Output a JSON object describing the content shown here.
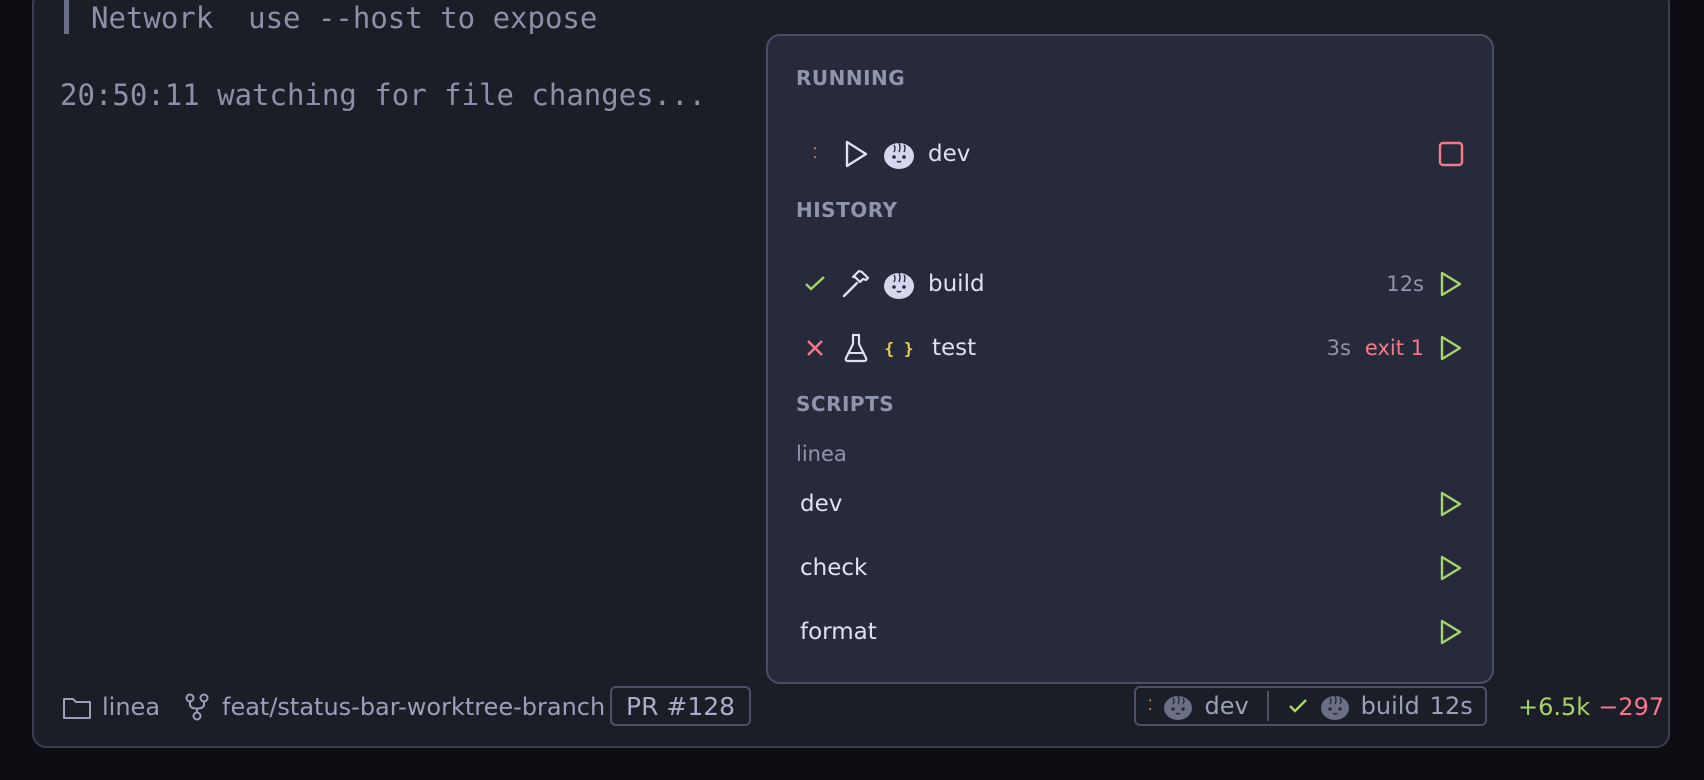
{
  "terminal": {
    "line1": "Network  use --host to expose",
    "line2": "20:50:11 watching for file changes..."
  },
  "popup": {
    "running": {
      "title": "RUNNING",
      "items": [
        {
          "label": "dev",
          "status_icon": "spinner-icon",
          "kind_icon": "play-icon",
          "runtime_icon": "bun-icon",
          "action_icon": "stop-icon"
        }
      ]
    },
    "history": {
      "title": "HISTORY",
      "items": [
        {
          "label": "build",
          "duration": "12s",
          "exit": "",
          "status_icon": "check-icon",
          "kind_icon": "hammer-icon",
          "runtime_icon": "bun-icon",
          "action_icon": "play-icon"
        },
        {
          "label": "test",
          "duration": "3s",
          "exit": "exit 1",
          "status_icon": "x-icon",
          "kind_icon": "flask-icon",
          "runtime_icon": "json-braces-icon",
          "action_icon": "play-icon"
        }
      ]
    },
    "scripts": {
      "title": "SCRIPTS",
      "group": "linea",
      "items": [
        {
          "label": "dev"
        },
        {
          "label": "check"
        },
        {
          "label": "format"
        }
      ]
    },
    "brace_glyph": "{ }"
  },
  "statusbar": {
    "folder": "linea",
    "branch": "feat/status-bar-worktree-branch",
    "pr": "PR #128",
    "running_task": "dev",
    "last_task": "build",
    "last_task_duration": "12s",
    "diff_added": "+6.5k",
    "diff_removed": "−297"
  },
  "colors": {
    "accent_green": "#a6d36a",
    "error_red": "#f27a8a",
    "warning_orange": "#f0a44a",
    "json_yellow": "#e8d25c"
  }
}
